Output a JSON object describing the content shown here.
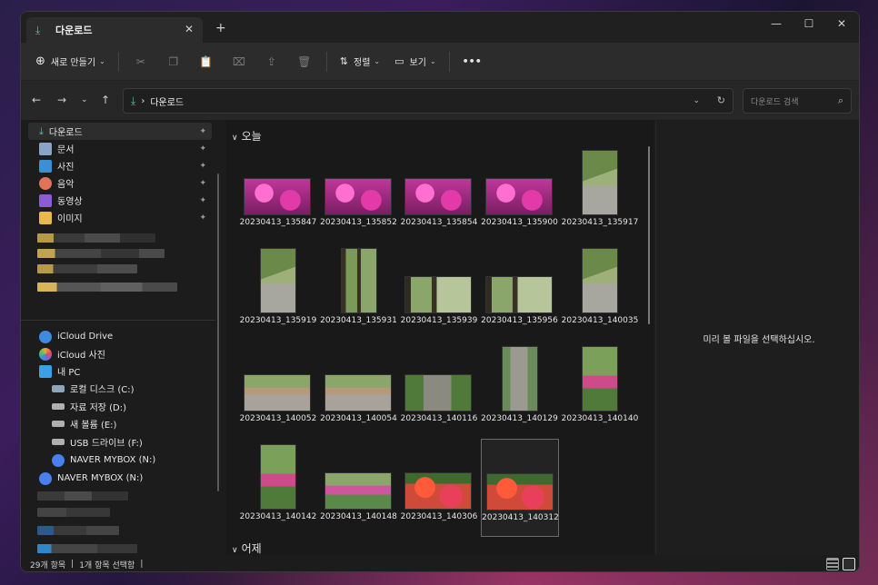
{
  "titlebar": {
    "tab_label": "다운로드",
    "tab_close": "✕",
    "new_tab": "+",
    "minimize": "—",
    "maximize": "☐",
    "close": "✕"
  },
  "toolbar": {
    "new_label": "새로 만들기",
    "sort_label": "정렬",
    "view_label": "보기",
    "more_label": "•••"
  },
  "address": {
    "path": "다운로드",
    "search_placeholder": "다운로드 검색"
  },
  "sidebar": {
    "pinned": [
      {
        "label": "다운로드",
        "icon": "download-icon",
        "color": "#4fc3a1"
      },
      {
        "label": "문서",
        "icon": "document-icon",
        "color": "#8aa4c8"
      },
      {
        "label": "사진",
        "icon": "pictures-icon",
        "color": "#3a8fd9"
      },
      {
        "label": "음악",
        "icon": "music-icon",
        "color": "#e0735a"
      },
      {
        "label": "동영상",
        "icon": "video-icon",
        "color": "#8b5cd6"
      },
      {
        "label": "이미지",
        "icon": "folder-icon",
        "color": "#e8b84a"
      }
    ],
    "drives": [
      {
        "label": "iCloud Drive",
        "icon": "icloud-icon"
      },
      {
        "label": "iCloud 사진",
        "icon": "icloud-photos-icon"
      },
      {
        "label": "내 PC",
        "icon": "pc-icon"
      },
      {
        "label": "로컬 디스크 (C:)",
        "icon": "drive-c-icon"
      },
      {
        "label": "자료 저장 (D:)",
        "icon": "drive-icon"
      },
      {
        "label": "새 볼륨 (E:)",
        "icon": "drive-icon"
      },
      {
        "label": "USB 드라이브 (F:)",
        "icon": "usb-drive-icon"
      },
      {
        "label": "NAVER MYBOX (N:)",
        "icon": "naver-mybox-icon"
      },
      {
        "label": "NAVER MYBOX (N:)",
        "icon": "naver-mybox-icon"
      }
    ]
  },
  "content": {
    "today_label": "오늘",
    "yesterday_label": "어제",
    "files": [
      {
        "name": "20230413_135847",
        "kind": "flowers"
      },
      {
        "name": "20230413_135852",
        "kind": "flowers"
      },
      {
        "name": "20230413_135854",
        "kind": "flowers"
      },
      {
        "name": "20230413_135900",
        "kind": "flowers"
      },
      {
        "name": "20230413_135917",
        "kind": "path-portrait"
      },
      {
        "name": "20230413_135919",
        "kind": "path-portrait"
      },
      {
        "name": "20230413_135931",
        "kind": "trees-portrait"
      },
      {
        "name": "20230413_135939",
        "kind": "trees"
      },
      {
        "name": "20230413_135956",
        "kind": "trees"
      },
      {
        "name": "20230413_140035",
        "kind": "path-portrait"
      },
      {
        "name": "20230413_140052",
        "kind": "plaza"
      },
      {
        "name": "20230413_140054",
        "kind": "plaza"
      },
      {
        "name": "20230413_140116",
        "kind": "trunk"
      },
      {
        "name": "20230413_140129",
        "kind": "trunk-portrait"
      },
      {
        "name": "20230413_140140",
        "kind": "garden-portrait"
      },
      {
        "name": "20230413_140142",
        "kind": "garden-portrait"
      },
      {
        "name": "20230413_140148",
        "kind": "garden"
      },
      {
        "name": "20230413_140306",
        "kind": "red-flowers"
      },
      {
        "name": "20230413_140312",
        "kind": "red-flowers"
      }
    ]
  },
  "preview": {
    "message": "미리 볼 파일을 선택하십시오."
  },
  "status": {
    "item_count": "29개 항목",
    "selected": "1개 항목 선택함",
    "sep": "|"
  }
}
